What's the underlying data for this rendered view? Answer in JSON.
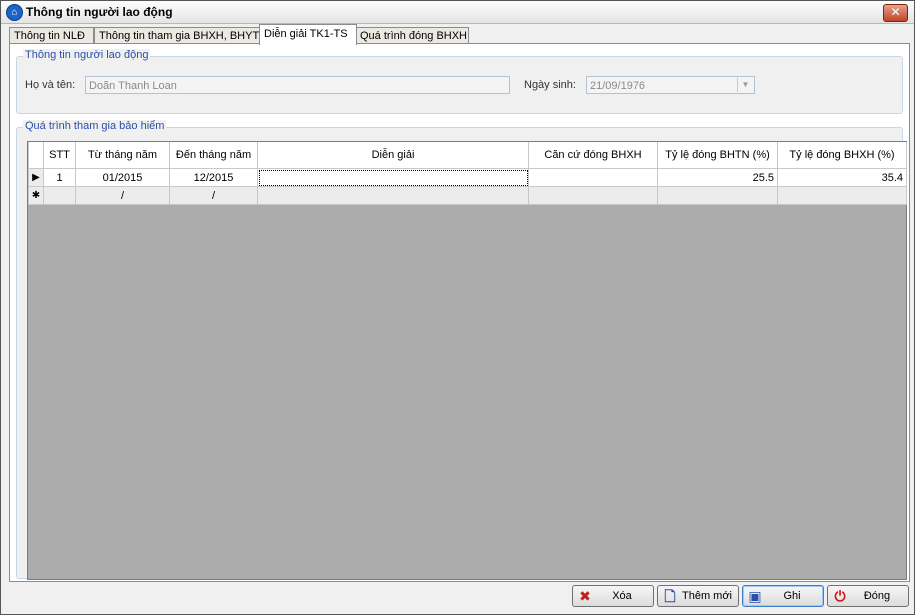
{
  "window": {
    "title": "Thông tin người lao động",
    "close_label": "✕"
  },
  "tabs": [
    {
      "label": "Thông tin NLĐ",
      "active": false
    },
    {
      "label": "Thông tin tham gia BHXH, BHYT",
      "active": false
    },
    {
      "label": "Diễn giải TK1-TS",
      "active": true
    },
    {
      "label": "Quá trình đóng BHXH",
      "active": false
    }
  ],
  "worker_info": {
    "legend": "Thông tin người lao động",
    "name_label": "Họ và tên:",
    "name_value": "Doãn Thanh Loan",
    "dob_label": "Ngày sinh:",
    "dob_value": "21/09/1976"
  },
  "insurance": {
    "legend": "Quá trình tham gia bảo hiểm",
    "columns": [
      "STT",
      "Từ tháng năm",
      "Đến tháng năm",
      "Diễn giải",
      "Căn cứ đóng BHXH",
      "Tỷ lệ đóng BHTN (%)",
      "Tỷ lệ đóng BHXH (%)"
    ],
    "rows": [
      {
        "indicator": "▶",
        "stt": "1",
        "from": "01/2015",
        "to": "12/2015",
        "desc": "",
        "basis": "",
        "bhtn": "25.5",
        "bhxh": "35.4"
      }
    ],
    "new_row": {
      "indicator": "✱",
      "from": "/",
      "to": "/"
    }
  },
  "buttons": {
    "delete": {
      "label": "Xóa",
      "icon": "x-icon",
      "color": "#c0201a"
    },
    "add": {
      "label": "Thêm mới",
      "icon": "new-document-icon",
      "color": "#2a4fa8"
    },
    "save": {
      "label": "Ghi",
      "icon": "floppy-disk-icon",
      "color": "#2a4fa8"
    },
    "close": {
      "label": "Đóng",
      "icon": "power-icon",
      "color": "#d01818"
    }
  }
}
